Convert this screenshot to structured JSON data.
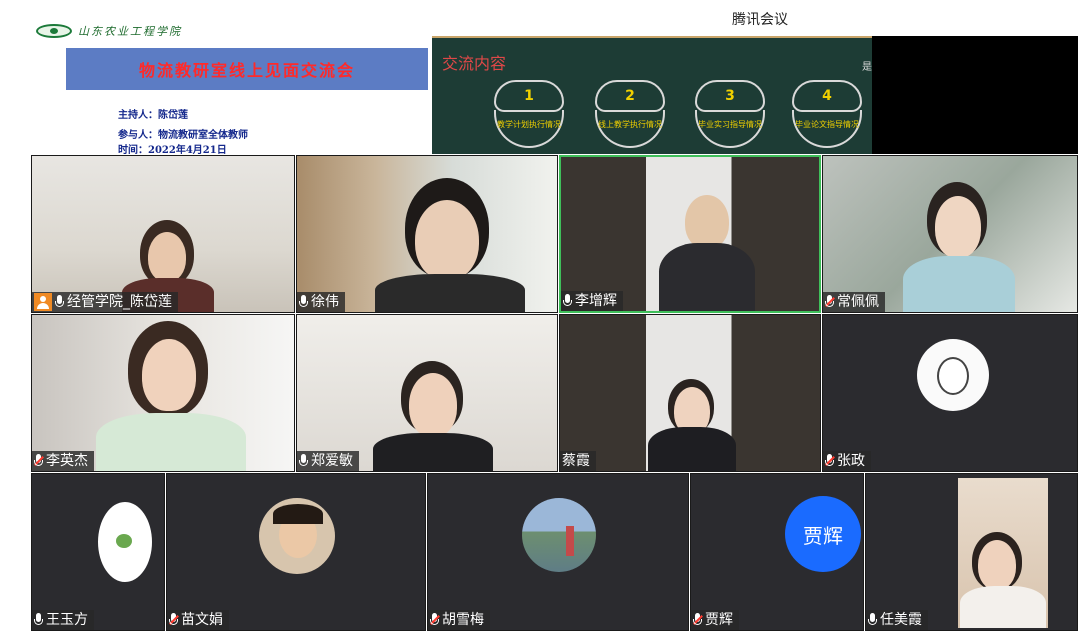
{
  "app": {
    "title": "腾讯会议"
  },
  "slide1": {
    "school": "山东农业工程学院",
    "banner": "物流教研室线上见面交流会",
    "host_line": "主持人：陈岱莲",
    "participants_line": "参与人：物流教研室全体教师",
    "time_line": "时间：2022年4月21日"
  },
  "slide2": {
    "title": "交流内容",
    "edge_text": "是",
    "topics": [
      {
        "num": "1",
        "label": "教学计划执行情况"
      },
      {
        "num": "2",
        "label": "线上教学执行情况"
      },
      {
        "num": "3",
        "label": "毕业实习指导情况"
      },
      {
        "num": "4",
        "label": "毕业论文指导情况"
      }
    ]
  },
  "participants": [
    {
      "name": "经管学院_陈岱莲",
      "role": "host",
      "mic": "on"
    },
    {
      "name": "徐伟",
      "mic": "on"
    },
    {
      "name": "李增辉",
      "mic": "on"
    },
    {
      "name": "常佩佩",
      "mic": "muted"
    },
    {
      "name": "李英杰",
      "mic": "muted"
    },
    {
      "name": "郑爱敏",
      "mic": "on"
    },
    {
      "name": "蔡霞",
      "mic": "none"
    },
    {
      "name": "张政",
      "mic": "muted"
    },
    {
      "name": "王玉方",
      "mic": "on"
    },
    {
      "name": "苗文娟",
      "mic": "muted"
    },
    {
      "name": "胡雪梅",
      "mic": "muted"
    },
    {
      "name": "贾辉",
      "mic": "muted",
      "avatar_text": "贾辉"
    },
    {
      "name": "任美霞",
      "mic": "on"
    }
  ],
  "colors": {
    "accent_blue": "#1a6bff",
    "host_orange": "#f08a24",
    "muted_red": "#ff3b30"
  }
}
